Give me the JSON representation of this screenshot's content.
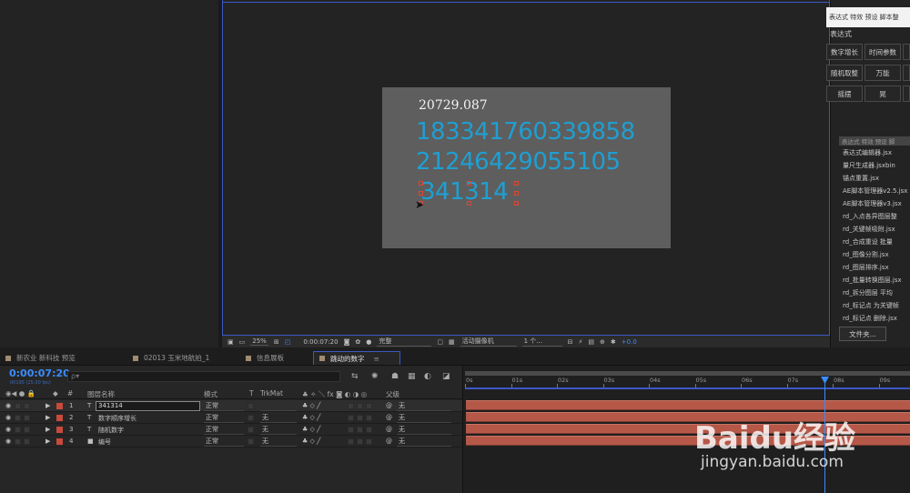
{
  "composition": {
    "lines": [
      "20729.087",
      "1833417603398​58",
      "21246429055105",
      "341314"
    ]
  },
  "viewer_bar": {
    "zoom": "25%",
    "timecode": "0:00:07:20",
    "quality": "完整",
    "camera": "活动摄像机",
    "views": "1 个...",
    "exposure": "+0.0"
  },
  "right_panel": {
    "header": "表达式 特效 预设 脚本整",
    "section_title": "表达式",
    "buttons": [
      "数字增长",
      "时间参数",
      "随机取整",
      "万能",
      "摇摆",
      "晃"
    ],
    "list_header": "表达式 特效 预设 脚",
    "list": [
      "表达式编辑器.jsx",
      "量尺生成器.jsxbin",
      "锚点重置.jsx",
      "AE脚本管理器v2.5.jsx",
      "AE脚本管理器v3.jsx",
      "rd_入点各异图层整",
      "rd_关键帧吸附.jsx",
      "rd_合成重设 批量",
      "rd_图像分割.jsx",
      "rd_图层排序.jsx",
      "rd_批量转换图层.jsx",
      "rd_拆分图层 平均",
      "rd_标记点 为关键帧",
      "rd_标记点 删除.jsx"
    ],
    "file_button": "文件夹..."
  },
  "tabs": [
    {
      "label": "新农业 新科技 预览",
      "active": false
    },
    {
      "label": "02013 玉米地航拍_1",
      "active": false
    },
    {
      "label": "信息展板",
      "active": false
    },
    {
      "label": "跳动的数字",
      "active": true
    }
  ],
  "timeline": {
    "timecode": "0:00:07:20",
    "fps": "00195 (25.00 fps)",
    "search_placeholder": "ρ▾",
    "columns": {
      "num": "#",
      "name": "图层名称",
      "mode": "模式",
      "t": "T",
      "trkmat": "TrkMat",
      "parent": "父级"
    },
    "layers": [
      {
        "num": "1",
        "type": "T",
        "name": "341314",
        "mode": "正常",
        "trkmat": "",
        "parent": "无",
        "selected": true,
        "color": "#c84a3c"
      },
      {
        "num": "2",
        "type": "T",
        "name": "数字顺序增长",
        "mode": "正常",
        "trkmat": "无",
        "parent": "无",
        "selected": false,
        "color": "#c84a3c"
      },
      {
        "num": "3",
        "type": "T",
        "name": "随机数字",
        "mode": "正常",
        "trkmat": "无",
        "parent": "无",
        "selected": false,
        "color": "#c84a3c"
      },
      {
        "num": "4",
        "type": "■",
        "name": "编号",
        "mode": "正常",
        "trkmat": "无",
        "parent": "无",
        "selected": false,
        "color": "#c84a3c"
      }
    ],
    "ruler_ticks": [
      "0s",
      "01s",
      "02s",
      "03s",
      "04s",
      "05s",
      "06s",
      "07s",
      "08s",
      "09s"
    ]
  },
  "watermark": {
    "brand": "Baidu经验",
    "url": "jingyan.baidu.com"
  }
}
